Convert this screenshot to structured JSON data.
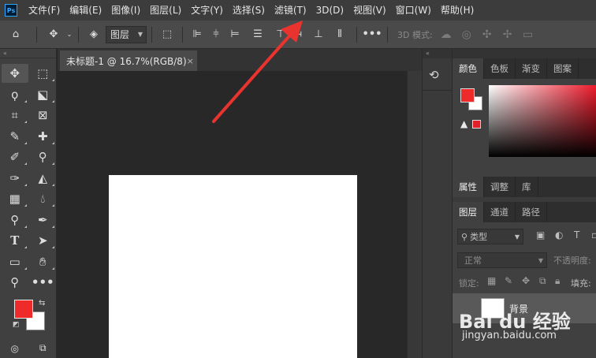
{
  "app": {
    "logo_text": "Ps"
  },
  "menu": [
    "文件(F)",
    "编辑(E)",
    "图像(I)",
    "图层(L)",
    "文字(Y)",
    "选择(S)",
    "滤镜(T)",
    "3D(D)",
    "视图(V)",
    "窗口(W)",
    "帮助(H)"
  ],
  "options_bar": {
    "layer_select": "图层",
    "mode_3d_label": "3D 模式:"
  },
  "document": {
    "tab_title": "未标题-1 @ 16.7%(RGB/8)",
    "close_glyph": "×"
  },
  "panels": {
    "color_tabs": [
      "颜色",
      "色板",
      "渐变",
      "图案"
    ],
    "properties_tabs": [
      "属性",
      "调整",
      "库"
    ],
    "layers_tabs": [
      "图层",
      "通道",
      "路径"
    ],
    "layers": {
      "filter_label": "类型",
      "blend_mode": "正常",
      "opacity_label": "不透明度:",
      "lock_label": "锁定:",
      "fill_label": "填充:",
      "layer_name": "背景"
    }
  },
  "colors": {
    "foreground": "#ee2a2a",
    "background": "#ffffff",
    "accent_arrow": "#e8332f"
  },
  "watermark": {
    "logo": "Bai du 经验",
    "url": "jingyan.baidu.com"
  }
}
